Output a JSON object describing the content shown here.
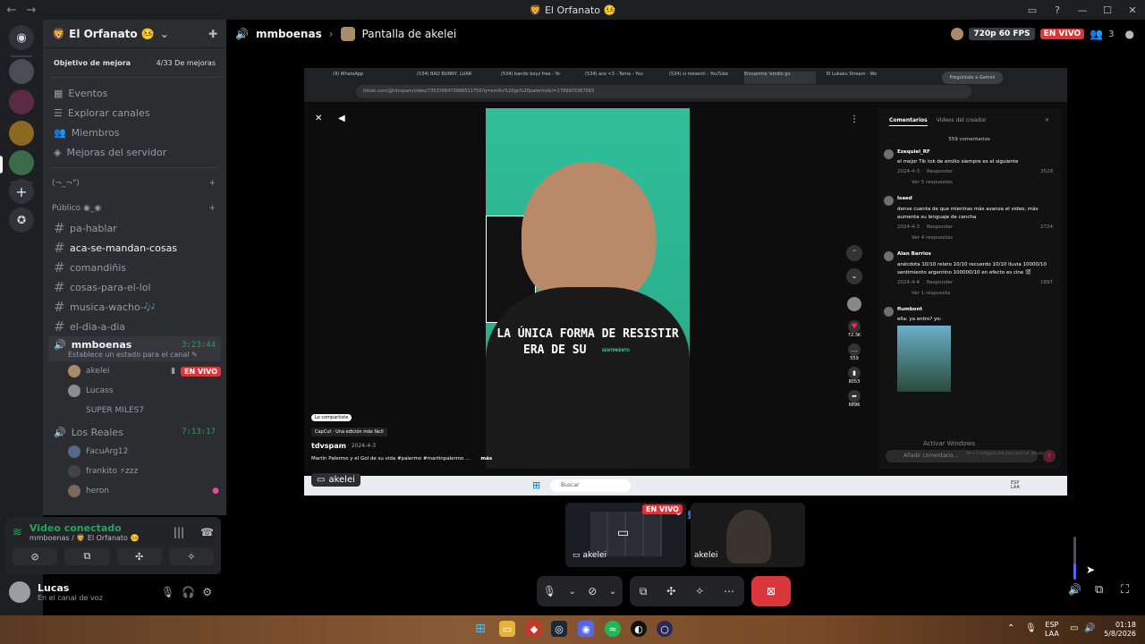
{
  "titlebar": {
    "title": "🦁 El Orfanato 🤒"
  },
  "server": {
    "name": "🦁 El Orfanato 🤒",
    "boost_goal": "Objetivo de mejora",
    "boost_progress": "4/33 De mejoras",
    "nav": [
      "Eventos",
      "Explorar canales",
      "Miembros",
      "Mejoras del servidor"
    ],
    "category1": "(¬_¬\")",
    "category2": "Público ◉_◉",
    "channels": [
      "pa-hablar",
      "aca-se-mandan-cosas",
      "comandiñis",
      "cosas-para-el-lol",
      "musica-wacho-🎶",
      "el-dia-a-dia"
    ],
    "voice1": {
      "name": "mmboenas",
      "time": "3:23:44",
      "status_prompt": "Establece un estado para el canal ✎"
    },
    "voice1_users": [
      "akelei",
      "Lucass",
      "SUPER MILES7"
    ],
    "live_badge": "EN VIVO",
    "voice2": {
      "name": "Los Reales",
      "time": "7:13:17"
    },
    "voice2_users": [
      "FacuArg12",
      "frankito ⚡zzz",
      "heron"
    ]
  },
  "voice_panel": {
    "status": "Video conectado",
    "location": "mmboenas / 🦁 El Orfanato 🤒"
  },
  "user_panel": {
    "name": "Lucas",
    "status": "En el canal de voz"
  },
  "header": {
    "channel": "mmboenas",
    "stream_title": "Pantalla de akelei",
    "quality": "720p 60 FPS",
    "live": "EN VIVO",
    "viewer_count": "3"
  },
  "browser": {
    "tabs": [
      "(9) WhatsApp",
      "(534) BAD BUNNY, LUAR",
      "(534) bando boyz free - Yo",
      "(534) ace <3 - Tema - You",
      "(534) si mesenti - YouTube",
      "Encuentra 'emilio go",
      "El Lukaku Stream - Wo"
    ],
    "gemini": "Pregúntale a Gemini",
    "url": "tiktok.com/@tdvspam/video/7353766470986511750?q=emilio%20go%20palermo&t=1789903387093"
  },
  "tiktok": {
    "caption_line1": "LA ÚNICA FORMA DE RESISTIR",
    "caption_line2": "ERA DE SU",
    "caption_small": "SENTIMIENTO",
    "shared_badge": "Lo compartiste",
    "capcut": "CapCut · Una edición más fácil",
    "author": "tdvspam",
    "date": "· 2024-4-3",
    "desc": "Martín Palermo y el Gol de su vida #palermo #martinpalermo ...",
    "more": "más",
    "likes": "72.3K",
    "comments": "559",
    "saves": "8053",
    "shares": "6896"
  },
  "comments_panel": {
    "tab_active": "Comentarios",
    "tab_other": "Videos del creador",
    "count": "559 comentarios",
    "items": [
      {
        "user": "Ezequiel_RF",
        "text": "el mejor Tik tok de emilio siempre es el siguiente",
        "date": "2024-4-3",
        "reply": "Responder",
        "likes": "3528",
        "more": "Ver 5 respuestas"
      },
      {
        "user": "Isaed",
        "text": "dense cuenta de que mientras más avanza el video, más aumenta su lenguaje de cancha",
        "date": "2024-4-3",
        "reply": "Responder",
        "likes": "2724",
        "more": "Ver 4 respuestas"
      },
      {
        "user": "Alan Barrios",
        "text": "anécdota 10/10 relato 10/10 recuerdo 10/10 lluvia 10000/10 sentimiento argentino 100000/10 en efecto es cine 🎬",
        "date": "2024-4-4",
        "reply": "Responder",
        "likes": "1897",
        "more": "Ver 1 respuesta"
      },
      {
        "user": "flumbont",
        "text": "ella: ya entro? yo:",
        "date": "",
        "reply": "",
        "likes": "",
        "more": ""
      }
    ],
    "input_placeholder": "Añadir comentario...",
    "watermark1": "Activar Windows",
    "watermark2": "Ve a Configuración para activar Windows."
  },
  "stream_label": "akelei",
  "inner_taskbar": {
    "search": "Buscar",
    "lang": "ESP LAA"
  },
  "thumbs": {
    "label1": "akelei",
    "label2": "akelei",
    "live": "EN VIVO"
  },
  "win_taskbar": {
    "lang1": "ESP",
    "lang2": "LAA",
    "time": "01:18",
    "date": "5/8/2026"
  },
  "colors": {
    "accent_red": "#da373c",
    "green": "#23a55a",
    "bg": "#2b2d31"
  }
}
